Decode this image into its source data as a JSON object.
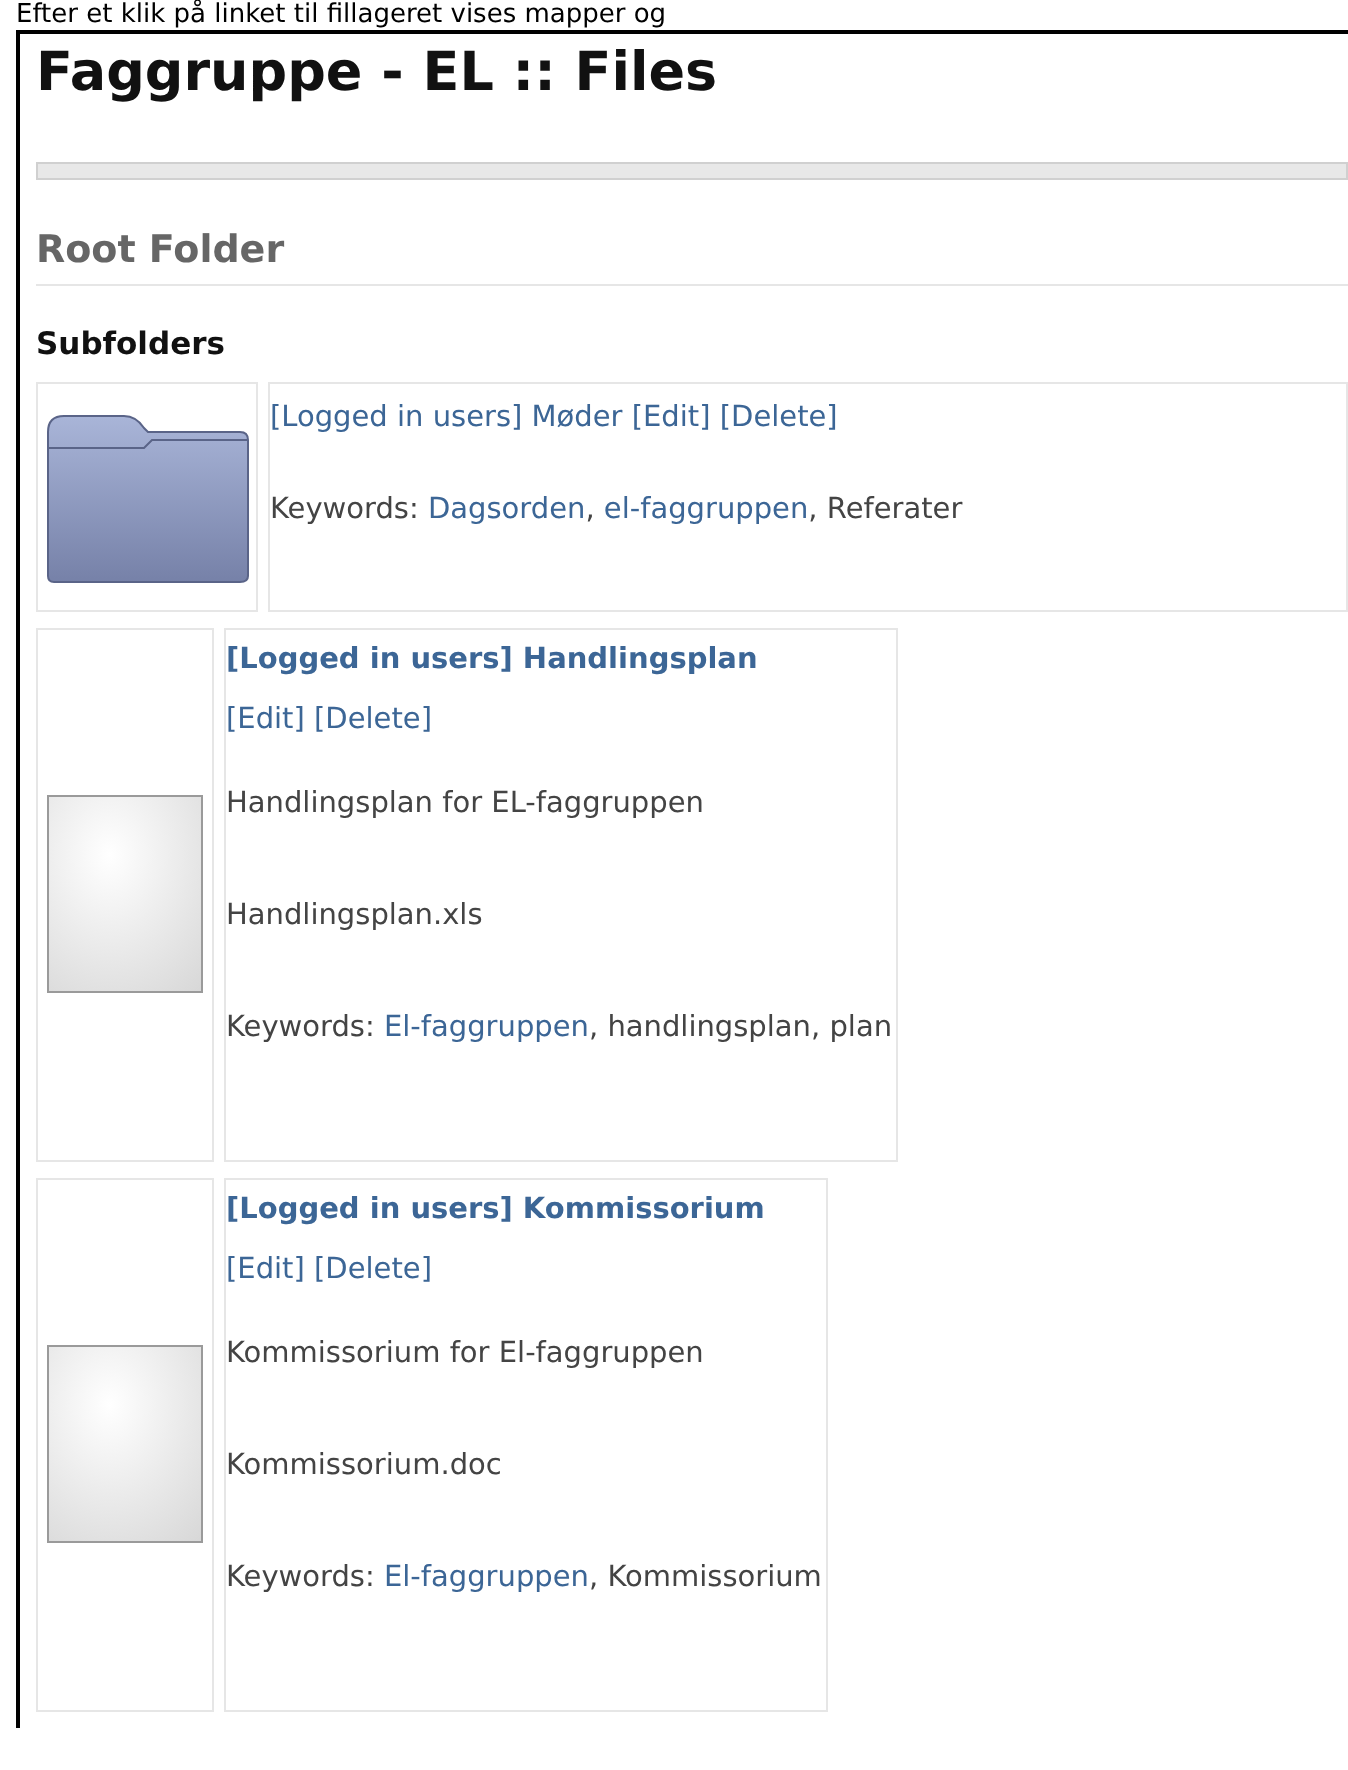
{
  "caption": "Efter et klik på linket til fillageret vises mapper og",
  "page_title": "Faggruppe - EL :: Files",
  "breadcrumb": "Root Folder",
  "subfolders_heading": "Subfolders",
  "items": [
    {
      "kind": "folder",
      "title": "[Logged in users] Møder",
      "actions": [
        "[Edit]",
        "[Delete]"
      ],
      "keywords": {
        "label": "Keywords:",
        "separator": ", ",
        "items": [
          {
            "text": "Dagsorden",
            "link": true
          },
          {
            "text": "el-faggruppen",
            "link": true
          },
          {
            "text": "Referater",
            "link": false
          }
        ]
      }
    },
    {
      "kind": "file",
      "title": "[Logged in users] Handlingsplan",
      "actions": [
        "[Edit]",
        "[Delete]"
      ],
      "description": "Handlingsplan for EL-faggruppen",
      "filename": "Handlingsplan.xls",
      "keywords": {
        "label": "Keywords:",
        "separator": ", ",
        "items": [
          {
            "text": "El-faggruppen",
            "link": true
          },
          {
            "text": "handlingsplan",
            "link": false
          },
          {
            "text": "plan",
            "link": false
          }
        ]
      }
    },
    {
      "kind": "file",
      "title": "[Logged in users] Kommissorium",
      "actions": [
        "[Edit]",
        "[Delete]"
      ],
      "description": "Kommissorium for El-faggruppen",
      "filename": "Kommissorium.doc",
      "keywords": {
        "label": "Keywords:",
        "separator": ", ",
        "items": [
          {
            "text": "El-faggruppen",
            "link": true
          },
          {
            "text": "Kommissorium",
            "link": false
          }
        ]
      }
    }
  ]
}
